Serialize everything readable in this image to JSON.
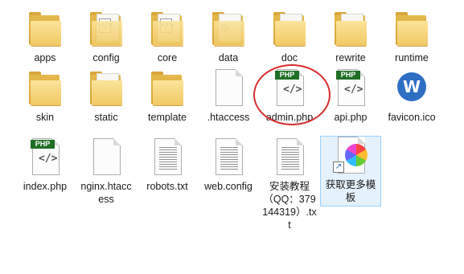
{
  "files": [
    {
      "label": "apps",
      "kind": "folder"
    },
    {
      "label": "config",
      "kind": "folder-code"
    },
    {
      "label": "core",
      "kind": "folder-code"
    },
    {
      "label": "data",
      "kind": "gear"
    },
    {
      "label": "doc",
      "kind": "folder"
    },
    {
      "label": "rewrite",
      "kind": "folder-paper"
    },
    {
      "label": "runtime",
      "kind": "folder"
    },
    {
      "label": "skin",
      "kind": "folder"
    },
    {
      "label": "static",
      "kind": "folder"
    },
    {
      "label": "template",
      "kind": "folder"
    },
    {
      "label": ".htaccess",
      "kind": "blank"
    },
    {
      "label": "admin.php",
      "kind": "php"
    },
    {
      "label": "api.php",
      "kind": "php"
    },
    {
      "label": "favicon.ico",
      "kind": "favicon"
    },
    {
      "label": "index.php",
      "kind": "php"
    },
    {
      "label": "nginx.htaccess",
      "kind": "blank"
    },
    {
      "label": "robots.txt",
      "kind": "txt"
    },
    {
      "label": "web.config",
      "kind": "txt"
    },
    {
      "label": "安装教程（QQ：379144319）.txt",
      "kind": "txt"
    },
    {
      "label": "获取更多模板",
      "kind": "shortcut"
    }
  ],
  "php_badge": "PHP",
  "code_glyph": "</>",
  "annotation": {
    "color": "#d72d2d",
    "target": "admin.php"
  }
}
